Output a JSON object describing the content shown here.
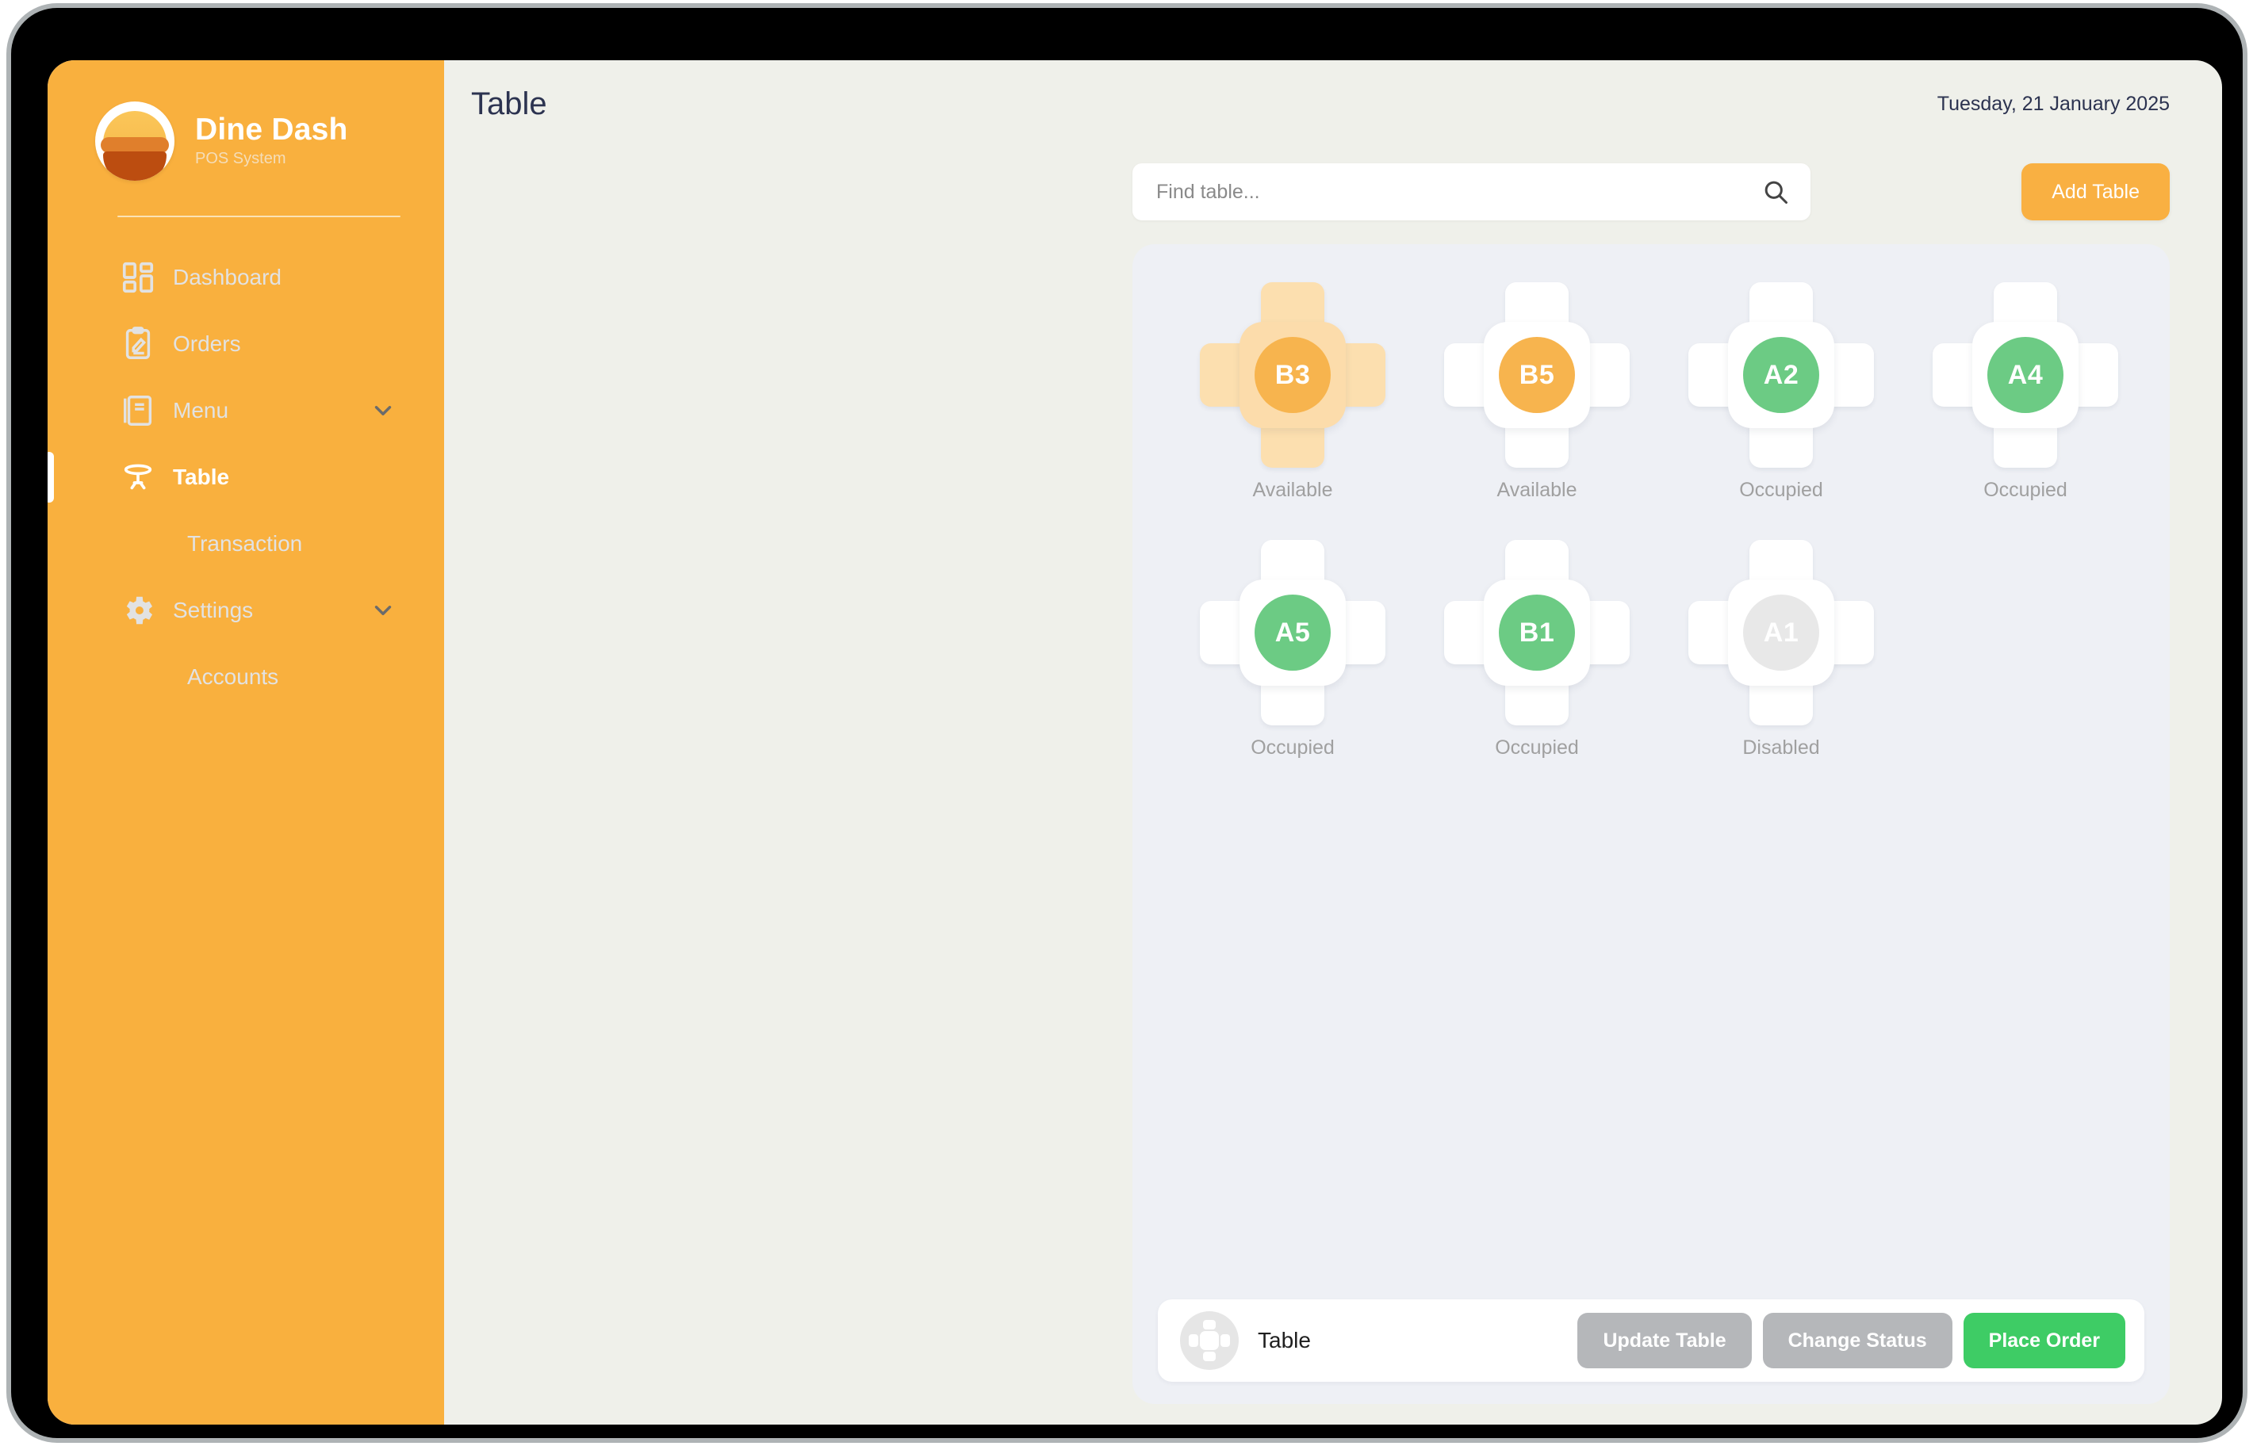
{
  "brand": {
    "title": "Dine Dash",
    "subtitle": "POS System",
    "logo_icon": "burger-logo-icon"
  },
  "colors": {
    "sidebar": "#f9b03e",
    "accent_orange": "#f9b042",
    "status_available": "#f7b44e",
    "status_occupied": "#6ccb84",
    "status_disabled": "#e6e6e6",
    "primary_green": "#3ecc65",
    "muted_gray": "#b5b7ba",
    "screen_bg": "#eff0ea",
    "board_bg": "#eef0f5"
  },
  "sidebar": {
    "items": [
      {
        "label": "Dashboard",
        "icon": "dashboard-grid-icon",
        "active": false,
        "chevron": false,
        "indented": false
      },
      {
        "label": "Orders",
        "icon": "clipboard-pencil-icon",
        "active": false,
        "chevron": false,
        "indented": false
      },
      {
        "label": "Menu",
        "icon": "book-icon",
        "active": false,
        "chevron": true,
        "indented": false
      },
      {
        "label": "Table",
        "icon": "pedestal-table-icon",
        "active": true,
        "chevron": false,
        "indented": false
      },
      {
        "label": "Transaction",
        "icon": "",
        "active": false,
        "chevron": false,
        "indented": true
      },
      {
        "label": "Settings",
        "icon": "gear-icon",
        "active": false,
        "chevron": true,
        "indented": false
      },
      {
        "label": "Accounts",
        "icon": "",
        "active": false,
        "chevron": false,
        "indented": true
      }
    ]
  },
  "header": {
    "title": "Table",
    "date": "Tuesday, 21 January 2025"
  },
  "toolbar": {
    "search_placeholder": "Find table...",
    "search_value": "",
    "search_icon": "search-icon",
    "add_table_label": "Add Table"
  },
  "tables": [
    {
      "id": "B3",
      "status": "Available",
      "state": "available",
      "selected": true
    },
    {
      "id": "B5",
      "status": "Available",
      "state": "available",
      "selected": false
    },
    {
      "id": "A2",
      "status": "Occupied",
      "state": "occupied",
      "selected": false
    },
    {
      "id": "A4",
      "status": "Occupied",
      "state": "occupied",
      "selected": false
    },
    {
      "id": "A5",
      "status": "Occupied",
      "state": "occupied",
      "selected": false
    },
    {
      "id": "B1",
      "status": "Occupied",
      "state": "occupied",
      "selected": false
    },
    {
      "id": "A1",
      "status": "Disabled",
      "state": "disabled",
      "selected": false
    }
  ],
  "action_bar": {
    "avatar_icon": "table-seat-icon",
    "title": "Table",
    "buttons": [
      {
        "label": "Update Table",
        "style": "muted"
      },
      {
        "label": "Change Status",
        "style": "muted"
      },
      {
        "label": "Place Order",
        "style": "primary"
      }
    ]
  }
}
